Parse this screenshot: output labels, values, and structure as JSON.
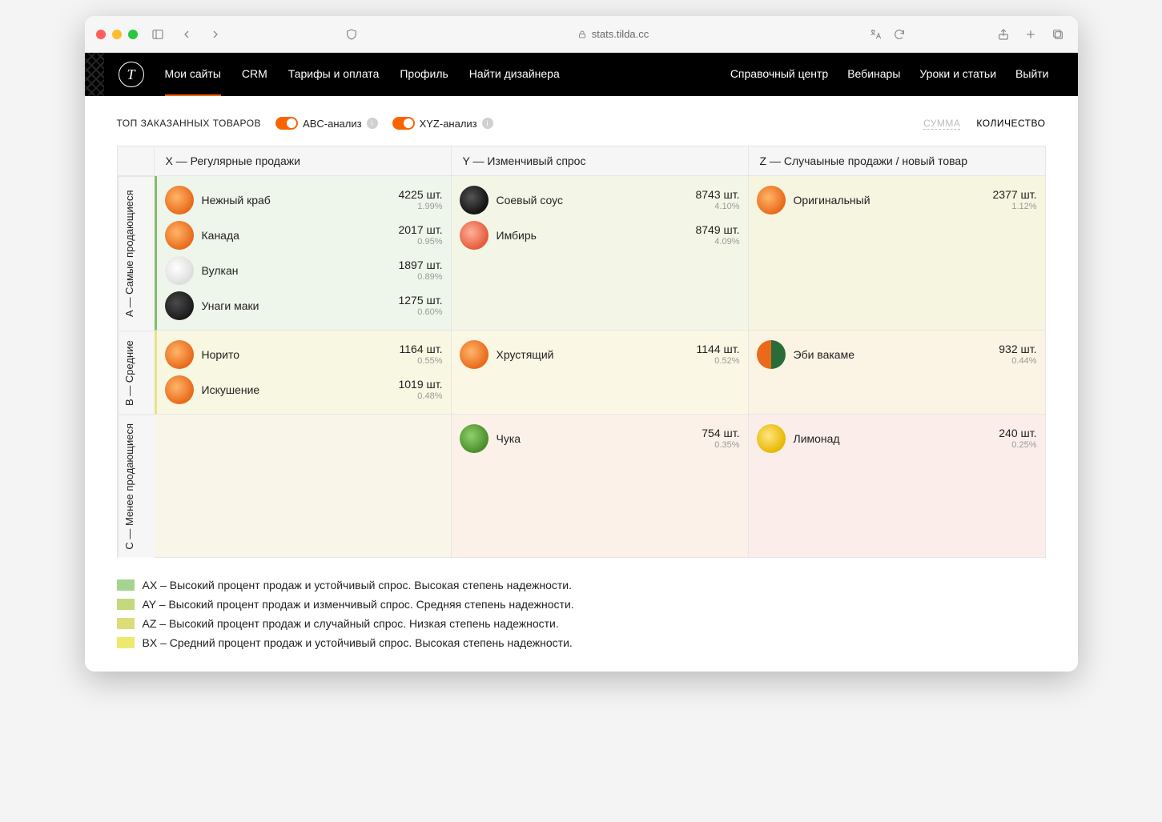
{
  "browser": {
    "url": "stats.tilda.cc"
  },
  "nav": {
    "logo_glyph": "T",
    "left": [
      "Мои сайты",
      "CRM",
      "Тарифы и оплата",
      "Профиль",
      "Найти дизайнера"
    ],
    "right": [
      "Справочный центр",
      "Вебинары",
      "Уроки и статьи",
      "Выйти"
    ],
    "active_index": 0
  },
  "controls": {
    "section_label": "ТОП ЗАКАЗАННЫХ ТОВАРОВ",
    "toggle_abc": "ABC-анализ",
    "toggle_xyz": "XYZ-анализ",
    "tab_sum": "СУММА",
    "tab_qty": "КОЛИЧЕСТВО",
    "active_tab": "sum"
  },
  "matrix": {
    "col_x": "X — Регулярные продажи",
    "col_y": "Y — Изменчивый спрос",
    "col_z": "Z — Случаыные продажи / новый товар",
    "row_a": "A — Самые продающиеся",
    "row_b": "B — Средние",
    "row_c": "C — Менее продающиеся",
    "unit": "шт."
  },
  "products": {
    "AX": [
      {
        "name": "Нежный краб",
        "qty": "4225",
        "pct": "1.99%",
        "thumb": "orange"
      },
      {
        "name": "Канада",
        "qty": "2017",
        "pct": "0.95%",
        "thumb": "orange"
      },
      {
        "name": "Вулкан",
        "qty": "1897",
        "pct": "0.89%",
        "thumb": "light"
      },
      {
        "name": "Унаги маки",
        "qty": "1275",
        "pct": "0.60%",
        "thumb": "dark"
      }
    ],
    "AY": [
      {
        "name": "Соевый соус",
        "qty": "8743",
        "pct": "4.10%",
        "thumb": "sauce"
      },
      {
        "name": "Имбирь",
        "qty": "8749",
        "pct": "4.09%",
        "thumb": "ginger"
      }
    ],
    "AZ": [
      {
        "name": "Оригинальный",
        "qty": "2377",
        "pct": "1.12%",
        "thumb": "orange"
      }
    ],
    "BX": [
      {
        "name": "Норито",
        "qty": "1164",
        "pct": "0.55%",
        "thumb": "orange"
      },
      {
        "name": "Искушение",
        "qty": "1019",
        "pct": "0.48%",
        "thumb": "orange"
      }
    ],
    "BY": [
      {
        "name": "Хрустящий",
        "qty": "1144",
        "pct": "0.52%",
        "thumb": "orange"
      }
    ],
    "BZ": [
      {
        "name": "Эби вакаме",
        "qty": "932",
        "pct": "0.44%",
        "thumb": "mixed"
      }
    ],
    "CX": [],
    "CY": [
      {
        "name": "Чука",
        "qty": "754",
        "pct": "0.35%",
        "thumb": "green"
      }
    ],
    "CZ": [
      {
        "name": "Лимонад",
        "qty": "240",
        "pct": "0.25%",
        "thumb": "drink"
      }
    ]
  },
  "legend": [
    {
      "code": "AX",
      "text": "AX – Высокий процент продаж и устойчивый спрос. Высокая степень надежности."
    },
    {
      "code": "AY",
      "text": "AY – Высокий процент продаж и изменчивый спрос. Средняя степень надежности."
    },
    {
      "code": "AZ",
      "text": "AZ – Высокий процент продаж и случайный спрос. Низкая степень надежности."
    },
    {
      "code": "BX",
      "text": "BX – Средний процент продаж и устойчивый спрос. Высокая степень надежности."
    }
  ]
}
